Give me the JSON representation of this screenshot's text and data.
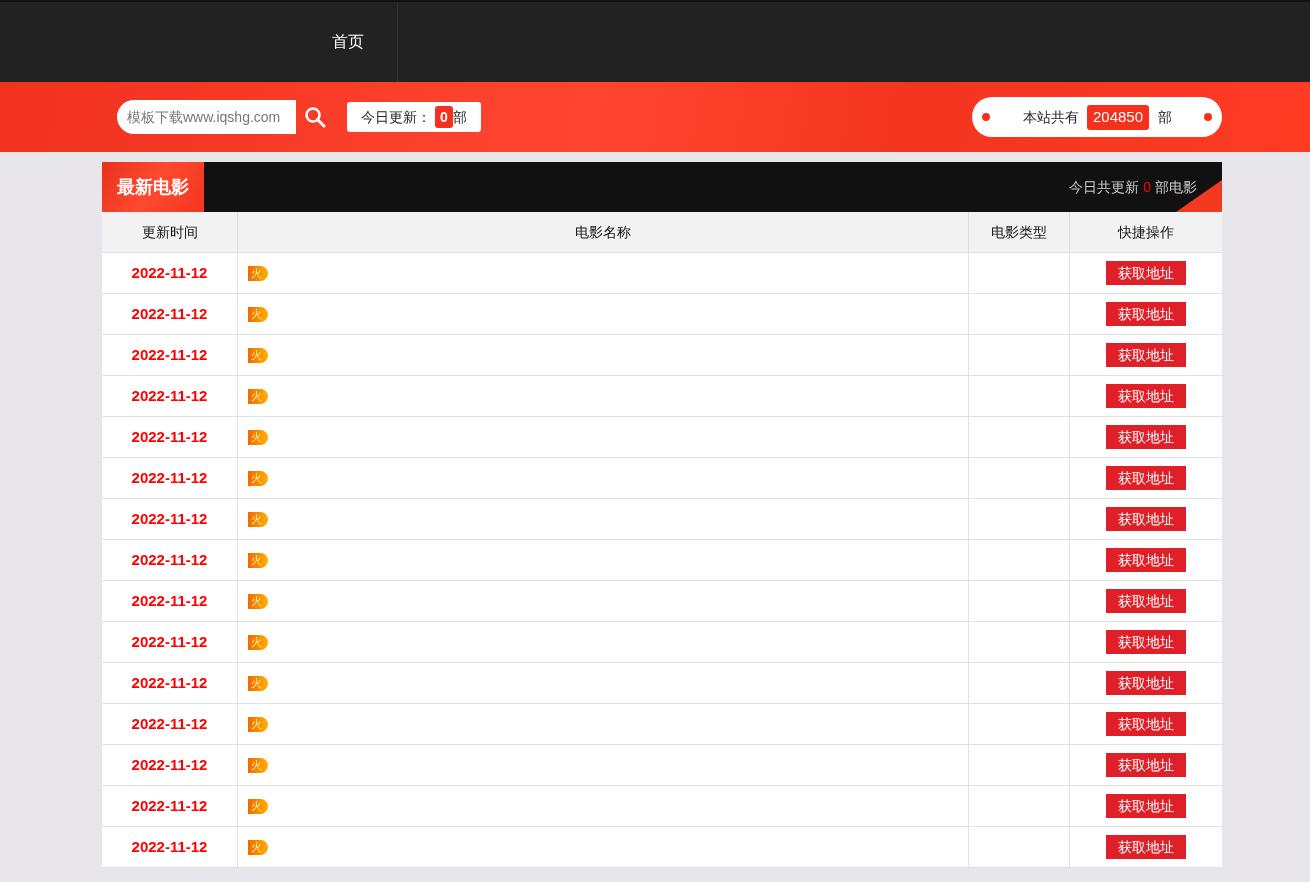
{
  "nav": {
    "items": [
      {
        "label": "首页",
        "selected": true
      }
    ]
  },
  "search": {
    "placeholder": "模板下载www.iqshg.com"
  },
  "today_update": {
    "label": "今日更新：",
    "count": "0",
    "unit": "部"
  },
  "site_total": {
    "label": "本站共有",
    "count": "204850",
    "unit": "部"
  },
  "section": {
    "title": "最新电影",
    "summary_prefix": "今日共更新",
    "summary_count": "0",
    "summary_suffix": "部电影"
  },
  "table": {
    "columns": [
      "更新时间",
      "电影名称",
      "电影类型",
      "快捷操作"
    ],
    "rows": [
      {
        "date": "2022-11-12",
        "badge": "火",
        "action": "获取地址"
      },
      {
        "date": "2022-11-12",
        "badge": "火",
        "action": "获取地址"
      },
      {
        "date": "2022-11-12",
        "badge": "火",
        "action": "获取地址"
      },
      {
        "date": "2022-11-12",
        "badge": "火",
        "action": "获取地址"
      },
      {
        "date": "2022-11-12",
        "badge": "火",
        "action": "获取地址"
      },
      {
        "date": "2022-11-12",
        "badge": "火",
        "action": "获取地址"
      },
      {
        "date": "2022-11-12",
        "badge": "火",
        "action": "获取地址"
      },
      {
        "date": "2022-11-12",
        "badge": "火",
        "action": "获取地址"
      },
      {
        "date": "2022-11-12",
        "badge": "火",
        "action": "获取地址"
      },
      {
        "date": "2022-11-12",
        "badge": "火",
        "action": "获取地址"
      },
      {
        "date": "2022-11-12",
        "badge": "火",
        "action": "获取地址"
      },
      {
        "date": "2022-11-12",
        "badge": "火",
        "action": "获取地址"
      },
      {
        "date": "2022-11-12",
        "badge": "火",
        "action": "获取地址"
      },
      {
        "date": "2022-11-12",
        "badge": "火",
        "action": "获取地址"
      },
      {
        "date": "2022-11-12",
        "badge": "火",
        "action": "获取地址"
      }
    ]
  }
}
